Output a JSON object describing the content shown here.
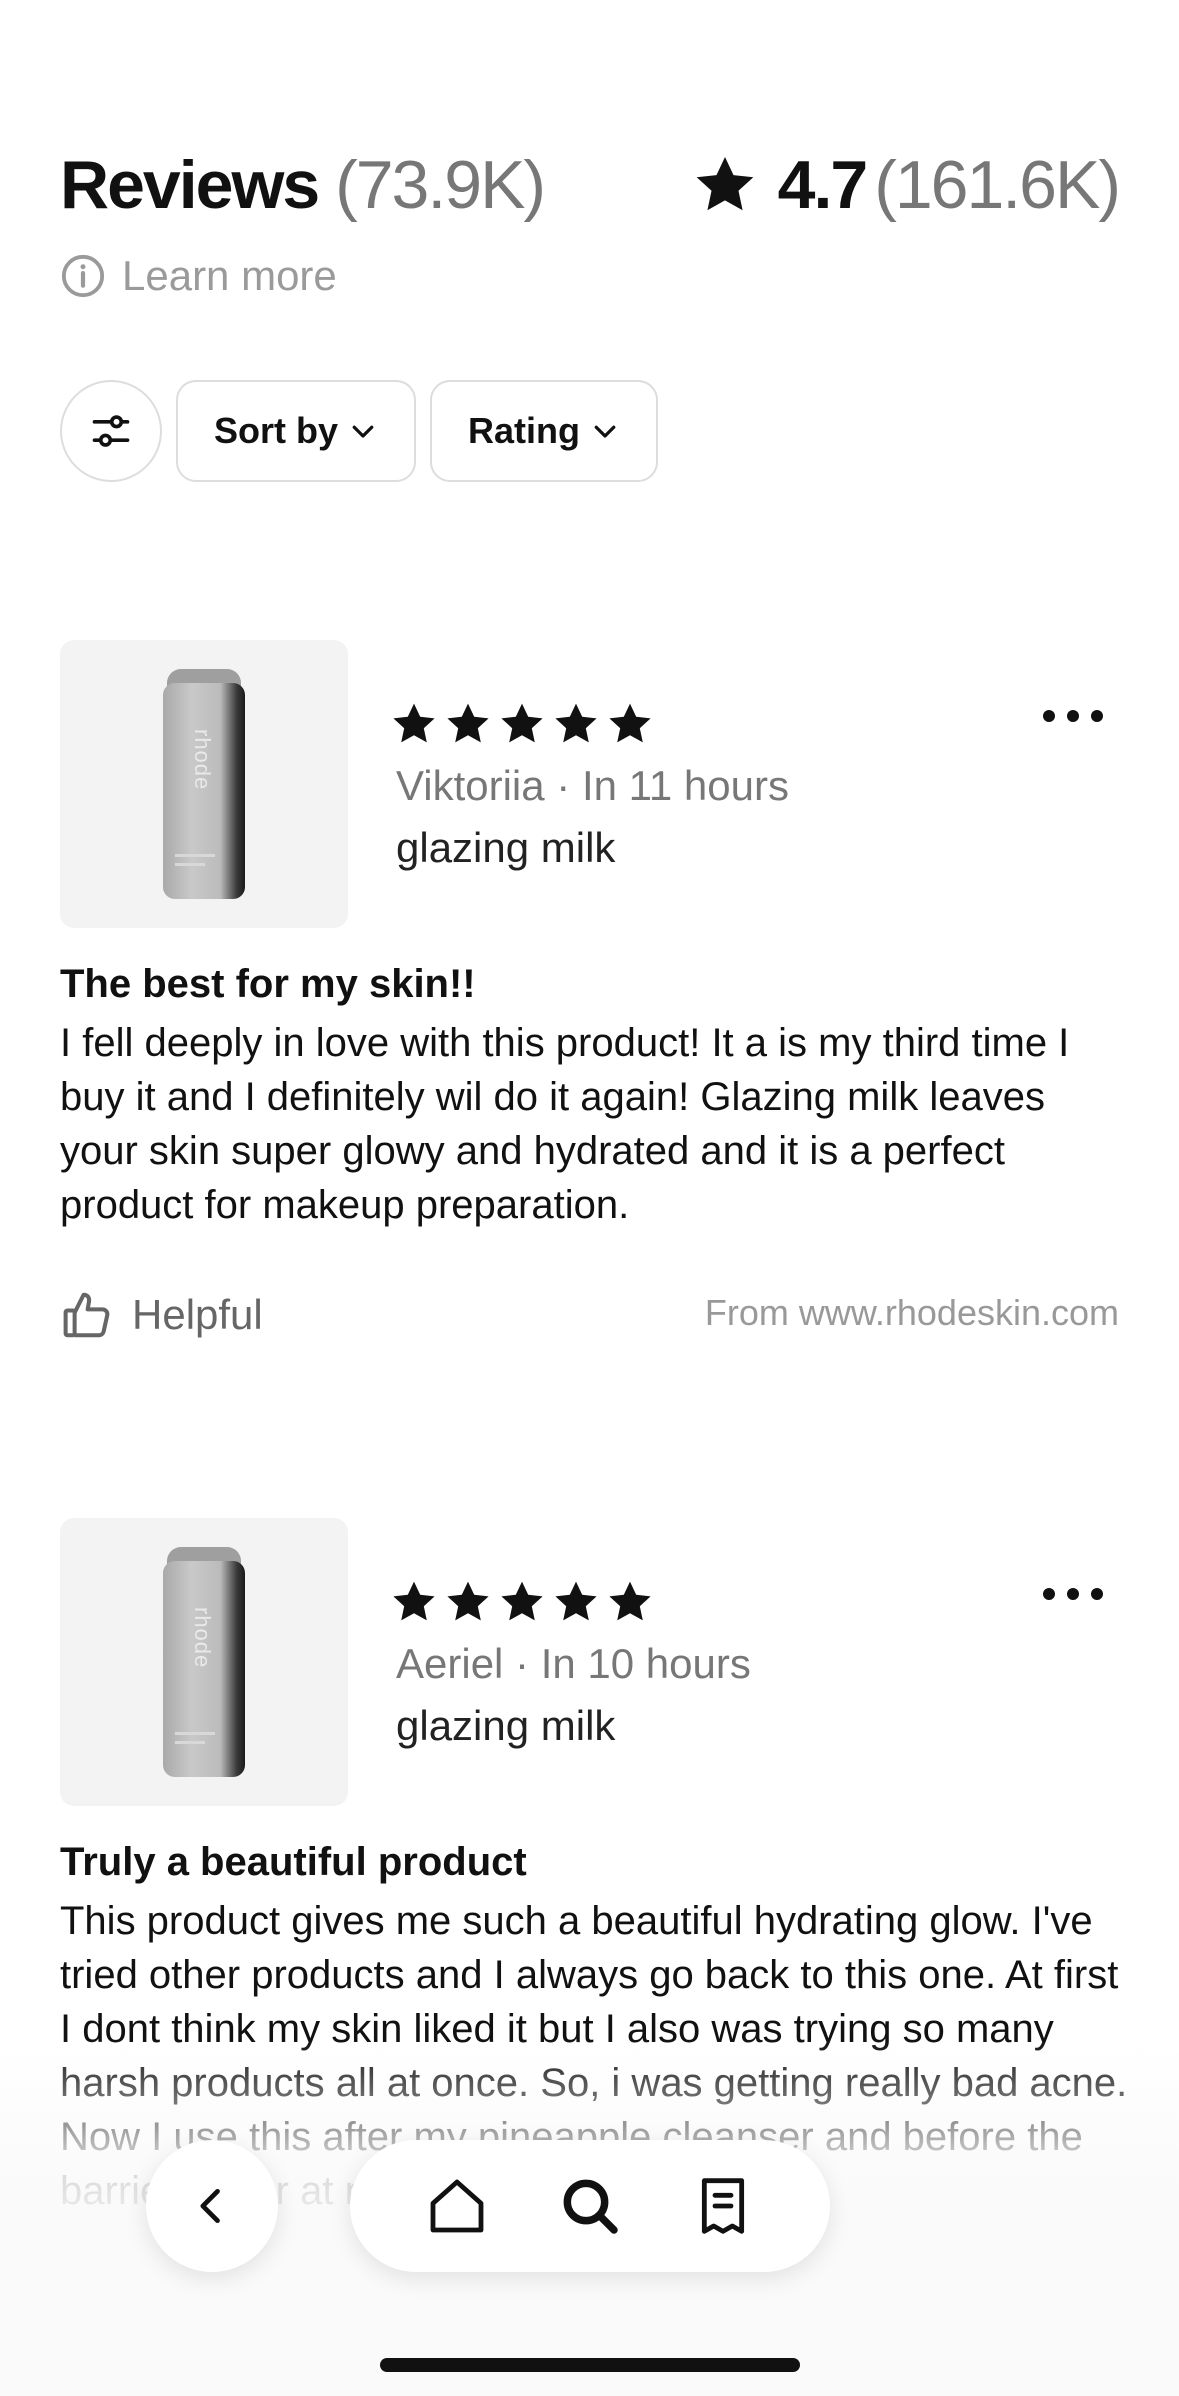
{
  "header": {
    "title": "Reviews",
    "review_count": "(73.9K)",
    "average_rating": "4.7",
    "rating_count": "(161.6K)",
    "learn_more": "Learn more"
  },
  "filters": {
    "sort_label": "Sort by",
    "rating_label": "Rating"
  },
  "reviews": [
    {
      "rating": 5,
      "author_line": "Viktoriia · In 11 hours",
      "product": "glazing milk",
      "title": "The best for my skin!!",
      "body": "I fell deeply in love with this product! It a is my third time I buy it and I definitely wil do it again! Glazing milk leaves your skin super glowy and hydrated and it is a perfect product for makeup preparation.",
      "helpful_label": "Helpful",
      "source": "From www.rhodeskin.com",
      "brand": "rhode"
    },
    {
      "rating": 5,
      "author_line": "Aeriel · In 10 hours",
      "product": "glazing milk",
      "title": "Truly a beautiful product",
      "body": "This product gives me such a beautiful hydrating glow. I've tried other products and I always go back to this one. At first I dont think my skin liked it but I also was trying so many harsh products all at once. So, i was getting really bad acne. Now I use this after my pineapple cleanser and before the barrier butter at night.",
      "brand": "rhode"
    }
  ],
  "icons": {
    "star": "star-icon",
    "info": "info-icon",
    "filter": "sliders-icon",
    "chevron": "chevron-down-icon",
    "more": "more-icon",
    "thumb": "thumbs-up-icon",
    "back": "chevron-left-icon",
    "home": "home-icon",
    "search": "search-icon",
    "receipt": "receipt-icon"
  }
}
